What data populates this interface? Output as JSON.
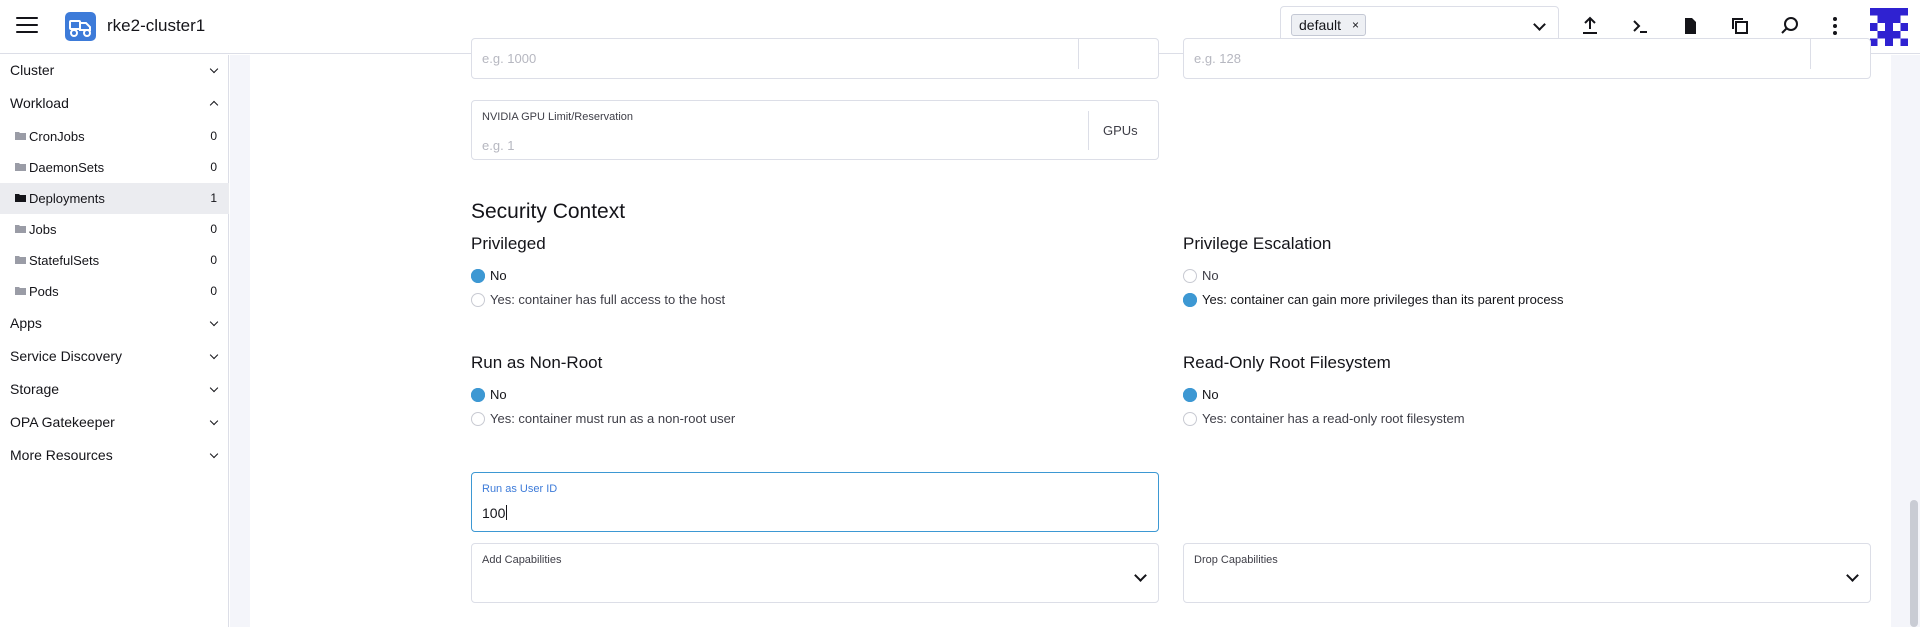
{
  "header": {
    "cluster_name": "rke2-cluster1",
    "namespace_chip": "default",
    "chip_remove": "×"
  },
  "sidebar": {
    "groups": {
      "cluster": "Cluster",
      "workload": "Workload",
      "apps": "Apps",
      "service_discovery": "Service Discovery",
      "storage": "Storage",
      "opa_gatekeeper": "OPA Gatekeeper",
      "more_resources": "More Resources"
    },
    "workload_items": [
      {
        "label": "CronJobs",
        "count": "0"
      },
      {
        "label": "DaemonSets",
        "count": "0"
      },
      {
        "label": "Deployments",
        "count": "1"
      },
      {
        "label": "Jobs",
        "count": "0"
      },
      {
        "label": "StatefulSets",
        "count": "0"
      },
      {
        "label": "Pods",
        "count": "0"
      }
    ]
  },
  "form": {
    "top_left_placeholder": "e.g. 1000",
    "top_right_placeholder": "e.g. 128",
    "gpu": {
      "label": "NVIDIA GPU Limit/Reservation",
      "placeholder": "e.g. 1",
      "suffix": "GPUs"
    },
    "security_context_title": "Security Context",
    "privileged": {
      "title": "Privileged",
      "no": "No",
      "yes": "Yes: container has full access to the host"
    },
    "privilege_escalation": {
      "title": "Privilege Escalation",
      "no": "No",
      "yes": "Yes: container can gain more privileges than its parent process"
    },
    "run_as_non_root": {
      "title": "Run as Non-Root",
      "no": "No",
      "yes": "Yes: container must run as a non-root user"
    },
    "read_only_root_fs": {
      "title": "Read-Only Root Filesystem",
      "no": "No",
      "yes": "Yes: container has a read-only root filesystem"
    },
    "run_as_user_id": {
      "label": "Run as User ID",
      "value": "100"
    },
    "add_capabilities": {
      "label": "Add Capabilities"
    },
    "drop_capabilities": {
      "label": "Drop Capabilities"
    }
  },
  "colors": {
    "accent": "#3d98d3",
    "brand": "#3d7bd9",
    "avatar": "#2f22d1"
  },
  "icons": [
    "menu-icon",
    "cluster-logo-icon",
    "upload-icon",
    "terminal-icon",
    "file-icon",
    "copy-icon",
    "search-icon",
    "more-vertical-icon",
    "folder-icon",
    "chevron-down-icon"
  ]
}
